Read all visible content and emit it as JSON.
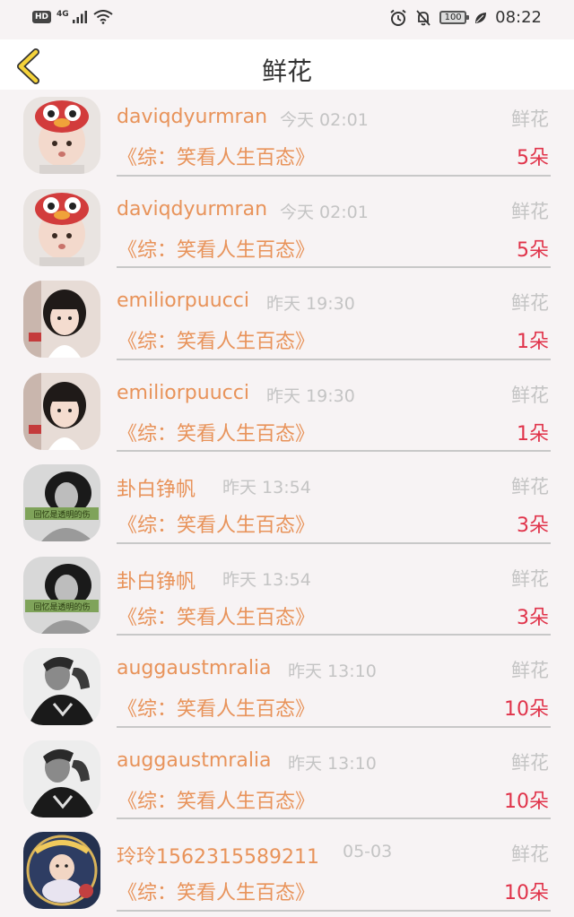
{
  "status_bar": {
    "hd": "HD",
    "network": "4G",
    "battery": "100",
    "time": "08:22"
  },
  "header": {
    "title": "鲜花",
    "back_icon": "chevron-left-icon"
  },
  "colors": {
    "accent": "#e8935a",
    "count": "#e0334a",
    "muted": "#c4c4c4",
    "back_icon": "#f5d33a"
  },
  "records": [
    {
      "user": "daviqdyurmran",
      "time": "今天 02:01",
      "gift": "鲜花",
      "show": "《综：笑看人生百态》",
      "count": "5朵"
    },
    {
      "user": "daviqdyurmran",
      "time": "今天 02:01",
      "gift": "鲜花",
      "show": "《综：笑看人生百态》",
      "count": "5朵"
    },
    {
      "user": "emiliorpuucci",
      "time": "昨天 19:30",
      "gift": "鲜花",
      "show": "《综：笑看人生百态》",
      "count": "1朵"
    },
    {
      "user": "emiliorpuucci",
      "time": "昨天 19:30",
      "gift": "鲜花",
      "show": "《综：笑看人生百态》",
      "count": "1朵"
    },
    {
      "user": "卦白铮帆",
      "time": "昨天 13:54",
      "gift": "鲜花",
      "show": "《综：笑看人生百态》",
      "count": "3朵",
      "avatar_caption": "回忆是透明的伤"
    },
    {
      "user": "卦白铮帆",
      "time": "昨天 13:54",
      "gift": "鲜花",
      "show": "《综：笑看人生百态》",
      "count": "3朵",
      "avatar_caption": "回忆是透明的伤"
    },
    {
      "user": "auggaustmralia",
      "time": "昨天 13:10",
      "gift": "鲜花",
      "show": "《综：笑看人生百态》",
      "count": "10朵"
    },
    {
      "user": "auggaustmralia",
      "time": "昨天 13:10",
      "gift": "鲜花",
      "show": "《综：笑看人生百态》",
      "count": "10朵"
    },
    {
      "user": "玲玲1562315589211",
      "time": "05-03",
      "gift": "鲜花",
      "show": "《综：笑看人生百态》",
      "count": "10朵"
    }
  ]
}
